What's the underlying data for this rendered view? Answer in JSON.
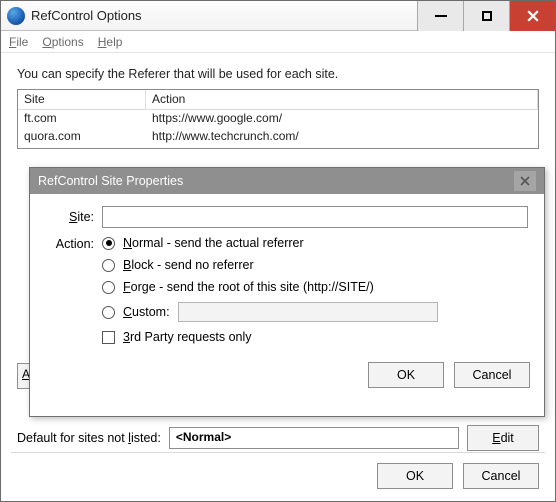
{
  "window": {
    "title": "RefControl Options"
  },
  "menu": {
    "file": "File",
    "options": "Options",
    "help": "Help"
  },
  "description": "You can specify the Referer that will be used for each site.",
  "table": {
    "headers": {
      "site": "Site",
      "action": "Action"
    },
    "rows": [
      {
        "site": "ft.com",
        "action": "https://www.google.com/"
      },
      {
        "site": "quora.com",
        "action": "http://www.techcrunch.com/"
      }
    ]
  },
  "left_button_stub": "A",
  "default": {
    "label_pre": "Default for sites not ",
    "label_u": "l",
    "label_post": "isted:",
    "value": "<Normal>",
    "edit_u": "E",
    "edit_rest": "dit"
  },
  "buttons": {
    "ok": "OK",
    "cancel": "Cancel"
  },
  "modal": {
    "title": "RefControl Site Properties",
    "site_u": "S",
    "site_rest": "ite:",
    "action_label": "Action:",
    "site_value": "",
    "options": {
      "normal_u": "N",
      "normal_rest": "ormal - send the actual referrer",
      "block_u": "B",
      "block_rest": "lock - send no referrer",
      "forge_u": "F",
      "forge_rest": "orge - send the root of this site (http://SITE/)",
      "custom_u": "C",
      "custom_rest": "ustom:",
      "custom_value": "",
      "third_u": "3",
      "third_rest": "rd Party requests only"
    },
    "ok": "OK",
    "cancel": "Cancel"
  }
}
